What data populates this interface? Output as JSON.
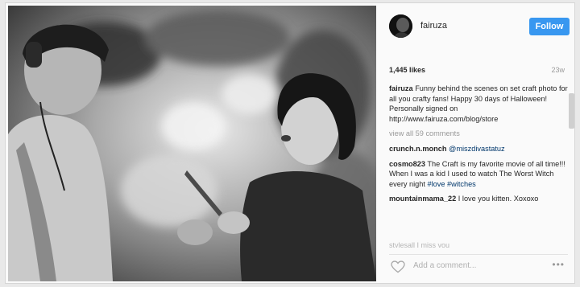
{
  "post": {
    "username": "fairuza",
    "follow_label": "Follow",
    "likes": "1,445 likes",
    "time_ago": "23w",
    "view_all": "view all 59 comments",
    "add_comment_placeholder": "Add a comment...",
    "more_glyph": "•••"
  },
  "caption": {
    "user": "fairuza",
    "text": "Funny behind the scenes on set craft photo for all you crafty fans! Happy 30 days of Halloween! Personally signed on http://www.fairuza.com/blog/store"
  },
  "comments": [
    {
      "user": "crunch.n.monch",
      "text": "",
      "link": "@miszdivastatuz"
    },
    {
      "user": "cosmo823",
      "text": "The Craft is my favorite movie of all time!!! When I was a kid I used to watch The Worst Witch every night",
      "link": "#love #witches"
    },
    {
      "user": "mountainmama_22",
      "text": "I love you kitten. Xoxoxo",
      "link": ""
    }
  ],
  "partial_comment": "stylesall I miss you",
  "colors": {
    "follow_bg": "#3897f0",
    "link": "#00376b",
    "muted": "#9a9a9a"
  }
}
